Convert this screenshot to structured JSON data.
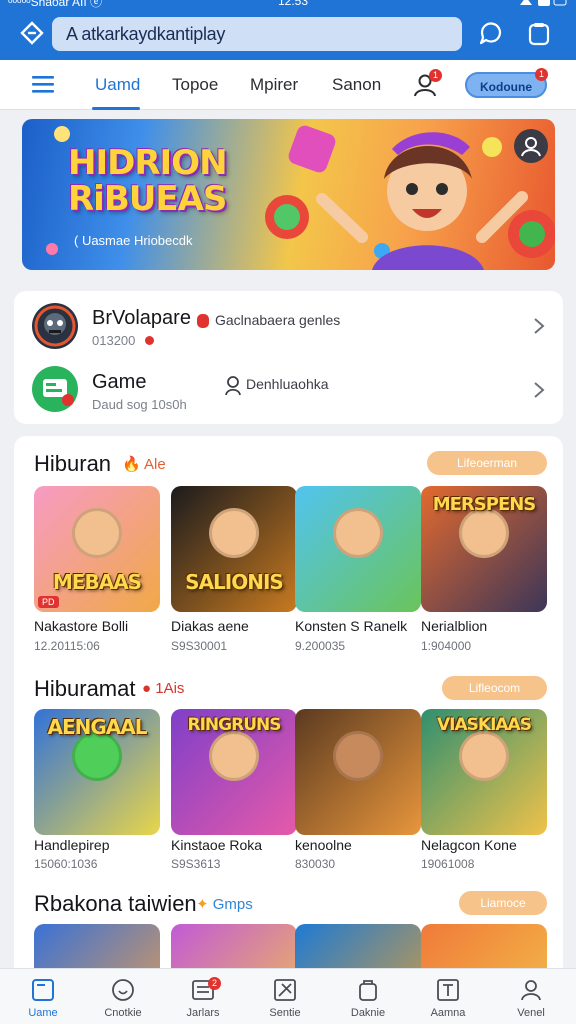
{
  "status_bar": {
    "carrier": "ᵒᵒᵒᵒᵒShaoar AII ⓔ",
    "clock": "12:53"
  },
  "browser": {
    "url": "A atkarkaydkantiplay"
  },
  "nav": {
    "tabs": [
      "Uamd",
      "Topoe",
      "Mpirer",
      "Sanon"
    ],
    "active_tab": 0,
    "profile_badge": "1",
    "pill_label": "Kodoune",
    "pill_badge": "1"
  },
  "banner": {
    "title_line1": "HIDRION",
    "title_line2": "RiBUEAS",
    "subtitle": "( Uasmae Hriobecdk"
  },
  "promos": [
    {
      "title": "BrVolapare",
      "desc": "Gaclnabaera genles",
      "meta": "013200",
      "icon": "avatar-icon"
    },
    {
      "title": "Game",
      "desc": "Denhluaohka",
      "meta": "Daud sog 10s0h",
      "icon": "chat-icon"
    }
  ],
  "sections": [
    {
      "title": "Hiburan",
      "tag": "Ale",
      "more": "Lifeoerman",
      "games": [
        {
          "name": "Nakastore Bolli",
          "meta": "12.20115:06",
          "art": "MEBAAS",
          "colors": [
            "#f79bc4",
            "#f0a946"
          ],
          "badge": "PD"
        },
        {
          "name": "Diakas aene",
          "meta": "S9S30001",
          "art": "SALIONIS",
          "colors": [
            "#1b1b1d",
            "#c87a20"
          ],
          "badge": ""
        },
        {
          "name": "Konsten S Ranelk",
          "meta": "9.200035",
          "art": "",
          "colors": [
            "#51c4f0",
            "#6ac45a"
          ],
          "badge": ""
        },
        {
          "name": "Nerialblion",
          "meta": "1:904000",
          "art": "MERSPENS",
          "colors": [
            "#e36a2f",
            "#3c3658"
          ],
          "badge": ""
        }
      ]
    },
    {
      "title": "Hiburamat",
      "tag": "1Ais",
      "more": "Lifleocom",
      "games": [
        {
          "name": "Handlepirep",
          "meta": "15060:1036",
          "art": "AENGAAL",
          "colors": [
            "#3272d8",
            "#e9d64a"
          ],
          "badge": ""
        },
        {
          "name": "Kinstaoe Roka",
          "meta": "S9S3613",
          "art": "RINGRUNS",
          "colors": [
            "#7f3fc9",
            "#e65aa9"
          ],
          "badge": ""
        },
        {
          "name": "kenoolne",
          "meta": "830030",
          "art": "",
          "colors": [
            "#5b3a20",
            "#e8963c"
          ],
          "badge": ""
        },
        {
          "name": "Nelagcon Kone",
          "meta": "19061008",
          "art": "VIASKIAAS",
          "colors": [
            "#2f8f6f",
            "#f0c24a"
          ],
          "badge": ""
        }
      ]
    },
    {
      "title": "Rbakona taiwien",
      "tag": "Gmps",
      "more": "Liamoce",
      "games": []
    }
  ],
  "bottom_nav": [
    {
      "label": "Uame",
      "icon": "home-icon"
    },
    {
      "label": "Cnotkie",
      "icon": "smile-icon"
    },
    {
      "label": "Jarlars",
      "icon": "list-icon",
      "badge": "2"
    },
    {
      "label": "Sentie",
      "icon": "tools-icon"
    },
    {
      "label": "Daknie",
      "icon": "bag-icon"
    },
    {
      "label": "Aamna",
      "icon": "text-icon"
    },
    {
      "label": "Venel",
      "icon": "person-icon"
    }
  ]
}
